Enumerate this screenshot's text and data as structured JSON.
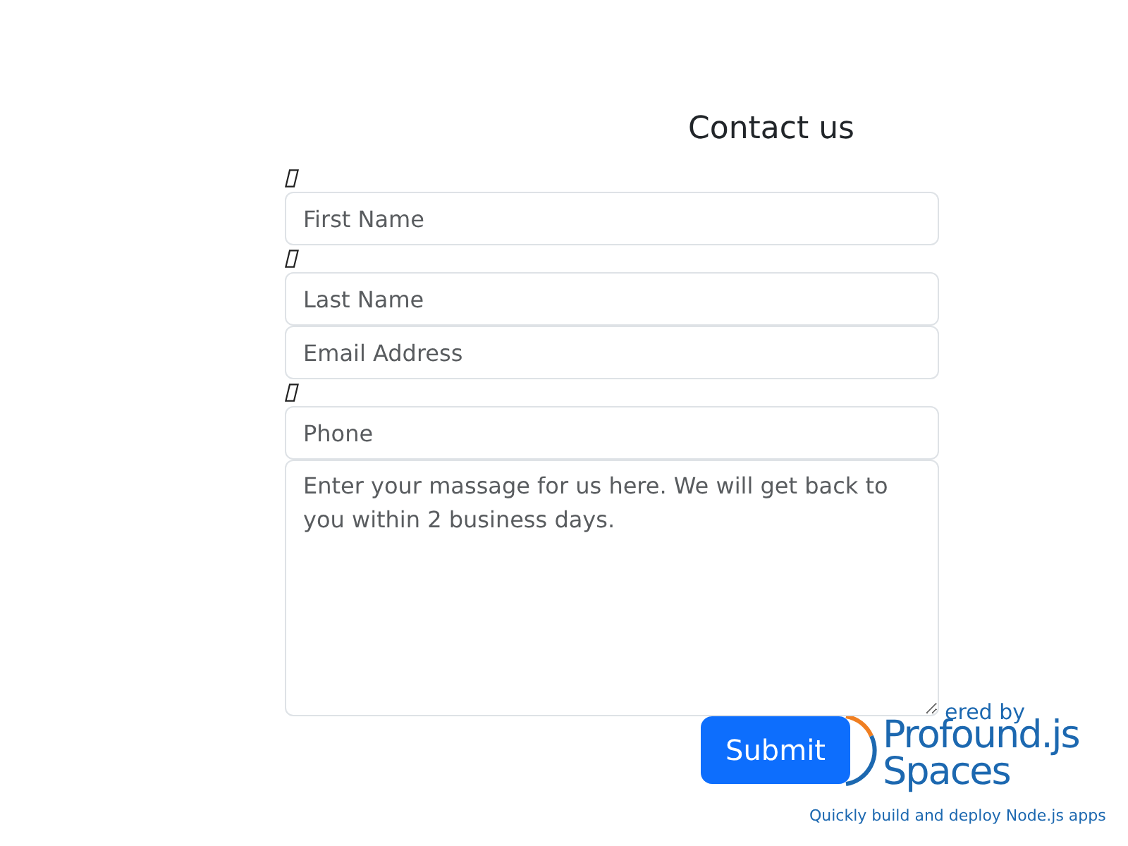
{
  "title": "Contact us",
  "fields": [
    {
      "placeholder": "First Name",
      "icon": true
    },
    {
      "placeholder": "Last Name",
      "icon": true
    },
    {
      "placeholder": "Email Address",
      "icon": false
    },
    {
      "placeholder": "Phone",
      "icon": true
    }
  ],
  "message": {
    "placeholder": "Enter your massage for us here. We will get back to you within 2 business days."
  },
  "submit": "Submit",
  "badge": {
    "powered": "ered by",
    "brand": "Profound.js",
    "product": "Spaces",
    "tagline": "Quickly build and deploy Node.js apps"
  }
}
